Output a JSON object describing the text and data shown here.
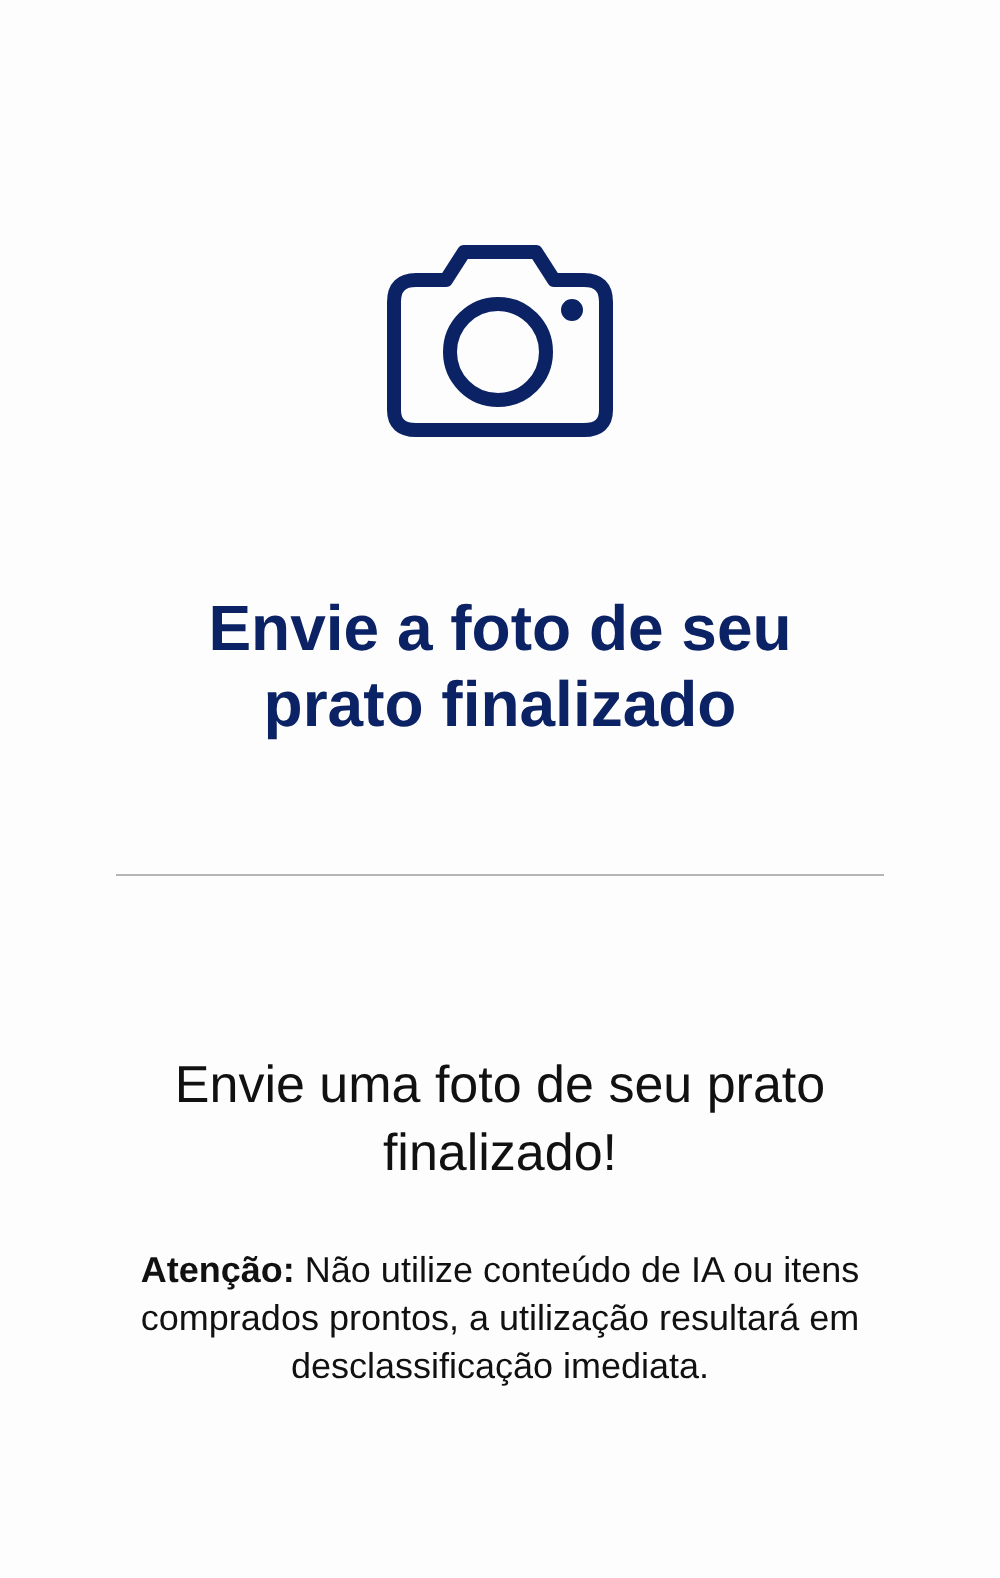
{
  "title": "Envie a foto de seu prato finalizado",
  "message": "Envie uma foto de seu prato finalizado!",
  "warning": "**Atenção:** Não utilize conteúdo de IA ou itens comprados prontos, a utilização resultará em desclassificação imediata."
}
